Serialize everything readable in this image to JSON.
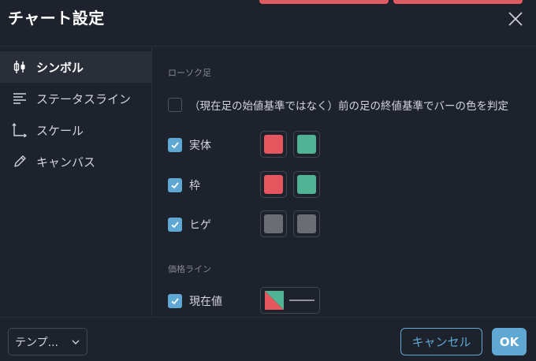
{
  "dialog": {
    "title": "チャート設定"
  },
  "sidebar": {
    "items": [
      {
        "label": "シンボル",
        "icon": "candlestick-icon",
        "active": true
      },
      {
        "label": "ステータスライン",
        "icon": "status-line-icon",
        "active": false
      },
      {
        "label": "スケール",
        "icon": "scale-axes-icon",
        "active": false
      },
      {
        "label": "キャンバス",
        "icon": "pencil-icon",
        "active": false
      }
    ]
  },
  "content": {
    "candles_section_title": "ローソク足",
    "option_prev_close": {
      "label": "（現在足の始値基準ではなく）前の足の終値基準でバーの色を判定",
      "checked": false
    },
    "body": {
      "label": "実体",
      "checked": true,
      "up_color": "#e5565f",
      "down_color": "#4fb394"
    },
    "border": {
      "label": "枠",
      "checked": true,
      "up_color": "#e5565f",
      "down_color": "#4fb394"
    },
    "wick": {
      "label": "ヒゲ",
      "checked": true,
      "up_color": "#6b6d72",
      "down_color": "#6b6d72"
    },
    "price_line_section_title": "価格ライン",
    "last_value": {
      "label": "現在値",
      "checked": true,
      "colors": [
        "#e5565f",
        "#4fb394"
      ]
    }
  },
  "footer": {
    "template_label": "テンプ...",
    "cancel_label": "キャンセル",
    "ok_label": "OK"
  },
  "colors": {
    "accent": "#5fa8d3",
    "background": "#1e222d",
    "strip": "#e05b5f"
  }
}
